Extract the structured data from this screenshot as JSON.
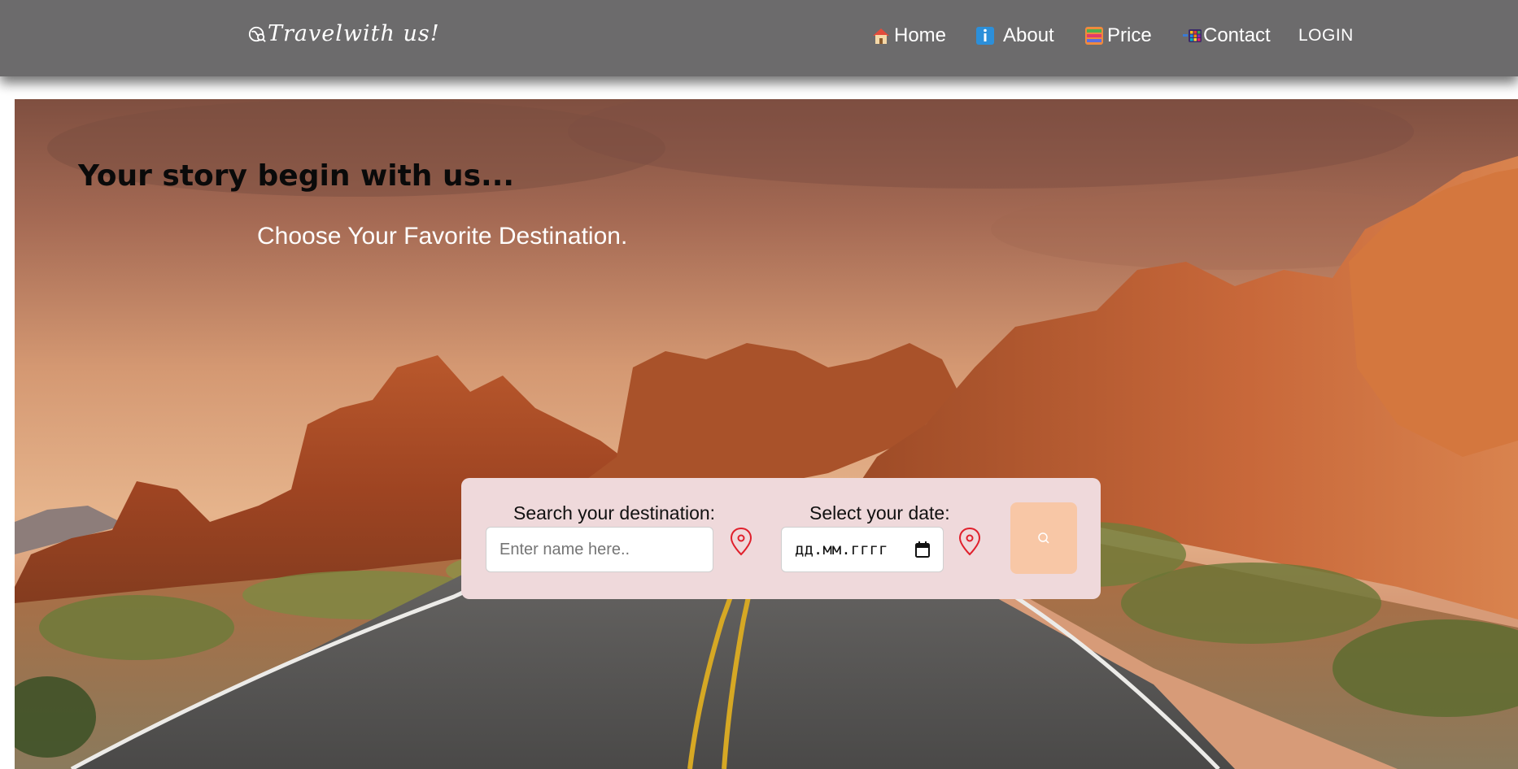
{
  "navbar": {
    "brand": "Travelwith us!",
    "items": [
      {
        "label": "Home",
        "icon": "house-icon"
      },
      {
        "label": "About",
        "icon": "info-icon"
      },
      {
        "label": "Price",
        "icon": "abacus-icon"
      },
      {
        "label": "Contact",
        "icon": "grid-icon"
      }
    ],
    "login_label": "LOGIN"
  },
  "hero": {
    "headline": "Your story begin with us...",
    "subline": "Choose Your Favorite Destination."
  },
  "search": {
    "destination_label": "Search your destination:",
    "destination_placeholder": "Enter name here..",
    "date_label": "Select your date:",
    "date_placeholder": "дд.мм.гггг",
    "button_icon": "search-icon"
  },
  "colors": {
    "navbar_bg": "#6c6b6c",
    "panel_bg": "#efd9db",
    "search_button": "#f8c7a6",
    "pin_red": "#e0202c"
  }
}
